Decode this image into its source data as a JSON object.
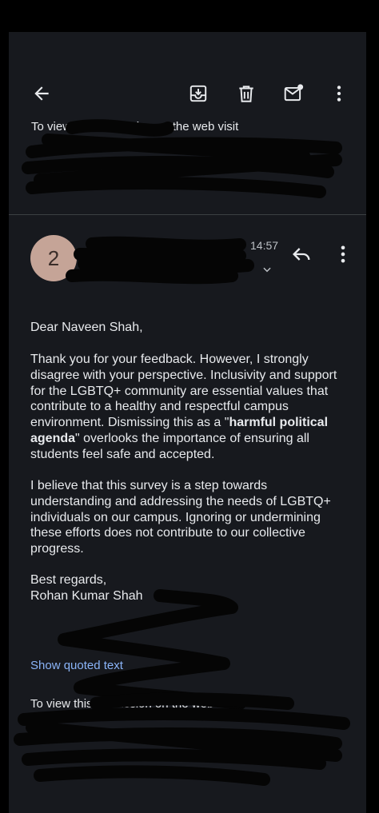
{
  "toolbar": {
    "back_icon": "arrow-back-icon",
    "archive_icon": "archive-icon",
    "delete_icon": "trash-icon",
    "mark_unread_icon": "mail-unread-icon",
    "more_icon": "more-vert-icon"
  },
  "previous_message": {
    "snippet": "To view this discussion on the web visit"
  },
  "message": {
    "avatar_letter": "2",
    "sender": "2...ha...",
    "time": "14:57",
    "recipients": "to ...ann...",
    "greeting": "Dear Naveen Shah,",
    "p1_before": "Thank you for your feedback. However, I strongly disagree with your perspective. Inclusivity and support for the LGBTQ+ community are essential values that contribute to a healthy and respectful campus environment. Dismissing this as a \"",
    "p1_bold": "harmful political agenda",
    "p1_after": "\" overlooks the importance of ensuring all students feel safe and accepted.",
    "p2": "I believe that this survey is a step towards understanding and addressing the needs of LGBTQ+ individuals on our campus. Ignoring or undermining these efforts does not contribute to our collective progress.",
    "closing": "Best regards,",
    "signature": "Rohan Kumar Shah",
    "show_quoted": "Show quoted text",
    "footer": "To view this discussion on the web visit"
  },
  "colors": {
    "background": "#17191e",
    "link": "#8ab4f8",
    "avatar": "#c5a497"
  }
}
